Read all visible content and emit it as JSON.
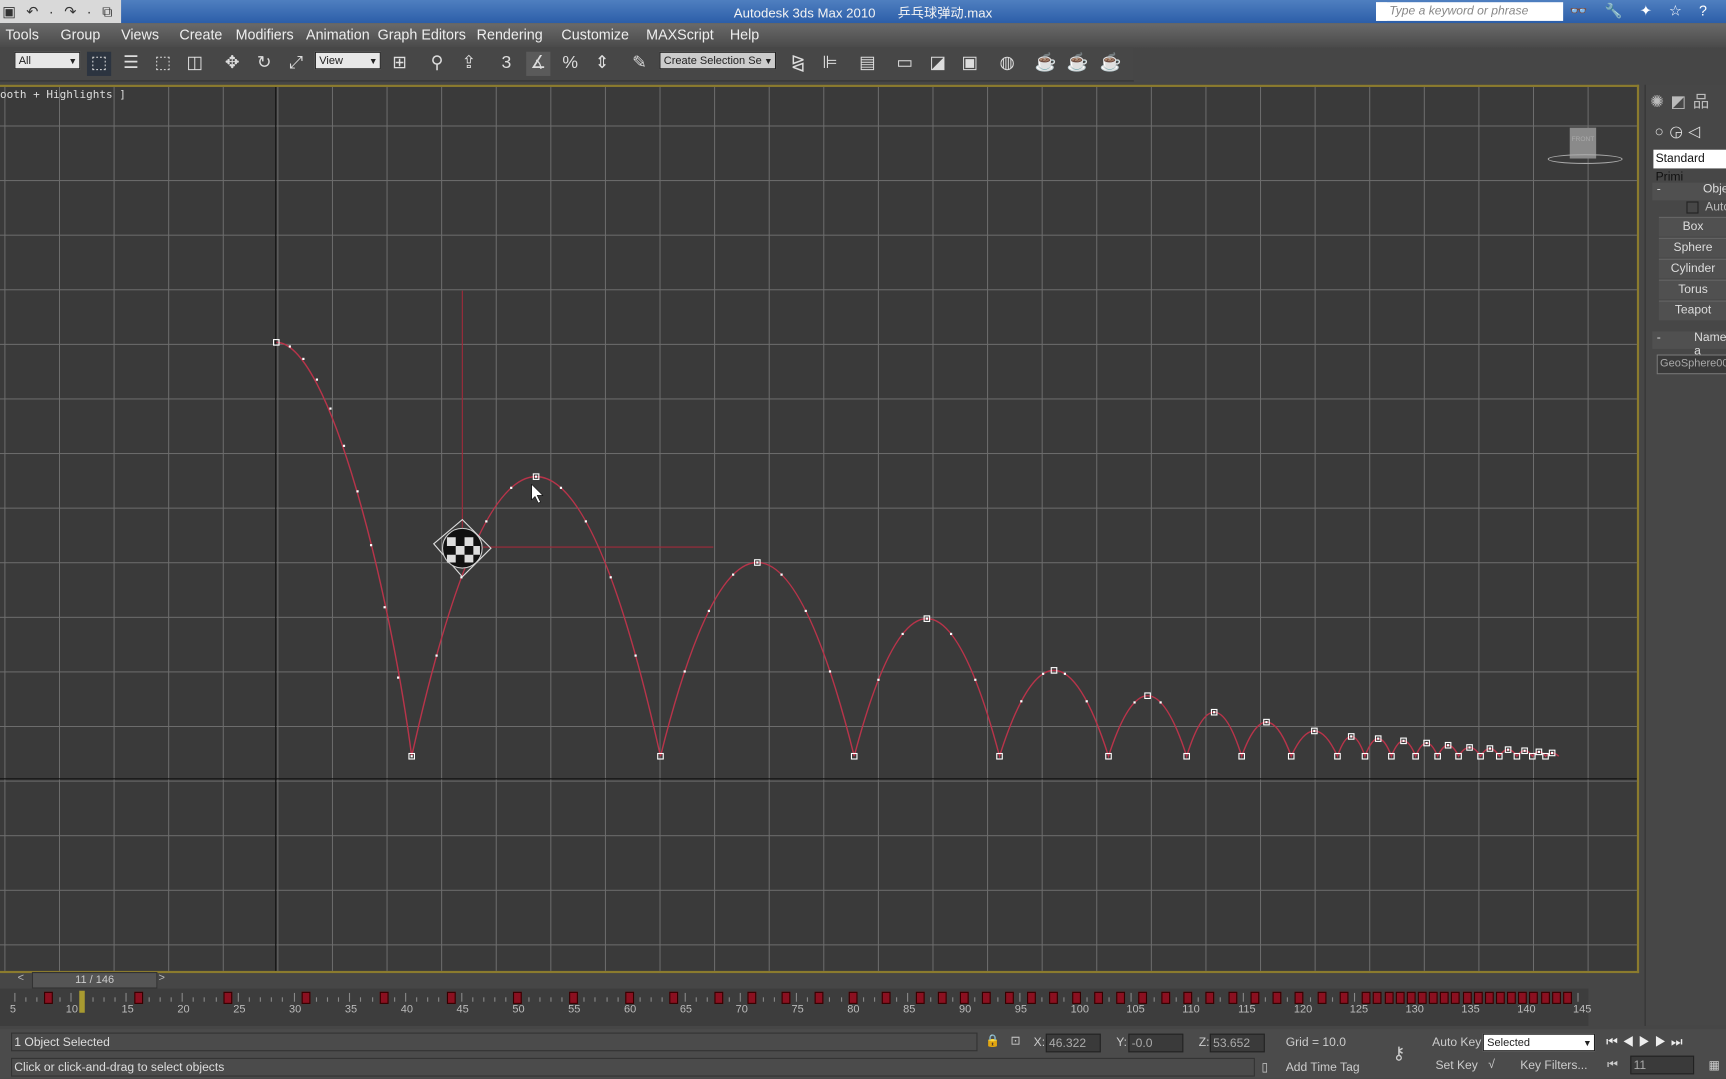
{
  "titlebar": {
    "app": "Autodesk 3ds Max  2010",
    "file": "乒乓球弹动.max",
    "quick_access": "▣ ↶ · ↷ · ⧉ ▾",
    "search_placeholder": "Type a keyword or phrase",
    "help_icons": "👓 🔧 ✦ ☆ ?"
  },
  "menu": [
    "Tools",
    "Group",
    "Views",
    "Create",
    "Modifiers",
    "Animation",
    "Graph Editors",
    "Rendering",
    "Customize",
    "MAXScript",
    "Help"
  ],
  "toolbar": {
    "filter": "All",
    "ref_coord": "View",
    "named_selection": "Create Selection Se",
    "snap_3": "3"
  },
  "viewport": {
    "label": "ooth + Highlights ]",
    "viewcube": "FRONT"
  },
  "command_panel": {
    "category": "Standard Primi",
    "rollout_object_type": "Obje",
    "autogrid": "Auto",
    "buttons": [
      "Box",
      "Sphere",
      "Cylinder",
      "Torus",
      "Teapot"
    ],
    "rollout_name": "Name a",
    "name_value": "GeoSphere00"
  },
  "timeline": {
    "slider": "11 / 146",
    "current_frame": 11,
    "total_frames": 146,
    "ticks": [
      "5",
      "10",
      "15",
      "20",
      "25",
      "30",
      "35",
      "40",
      "45",
      "50",
      "55",
      "60",
      "65",
      "70",
      "75",
      "80",
      "85",
      "90",
      "95",
      "100",
      "105",
      "110",
      "115",
      "120",
      "125",
      "130",
      "135",
      "140",
      "145"
    ]
  },
  "status": {
    "selection": "1 Object Selected",
    "prompt": "Click or click-and-drag to select objects",
    "x_label": "X:",
    "x": "46.322",
    "y_label": "Y:",
    "y": "-0.0",
    "z_label": "Z:",
    "z": "53.652",
    "grid": "Grid = 10.0",
    "add_time_tag": "Add Time Tag",
    "auto_key": "Auto Key",
    "set_key": "Set Key",
    "key_mode": "Selected",
    "key_filters": "Key Filters...",
    "frame": "11"
  },
  "colors": {
    "trajectory": "#b8344a",
    "keyframe": "#8b1020",
    "viewport_border": "#8b7b2e"
  }
}
